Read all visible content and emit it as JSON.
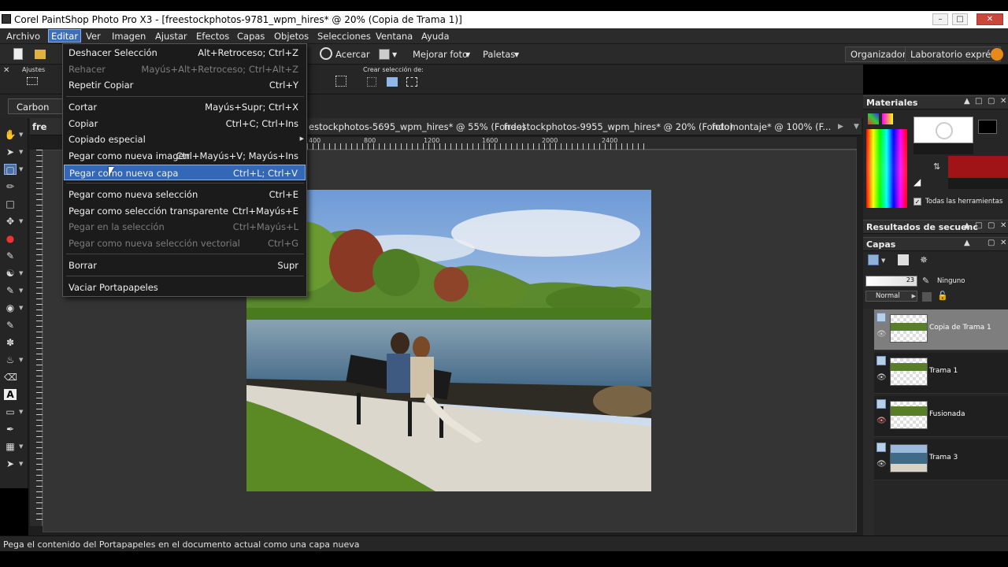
{
  "window": {
    "title": "Corel PaintShop Photo Pro X3 - [freestockphotos-9781_wpm_hires* @  20% (Copia de Trama 1)]",
    "controls": [
      "minimize-icon",
      "maximize-icon",
      "close-icon"
    ]
  },
  "menubar": [
    "Archivo",
    "Editar",
    "Ver",
    "Imagen",
    "Ajustar",
    "Efectos",
    "Capas",
    "Objetos",
    "Selecciones",
    "Ventana",
    "Ayuda"
  ],
  "toolbar": {
    "zoom_label": "Acercar",
    "enhance_label": "Mejorar foto",
    "palettes_label": "Paletas",
    "organizer_label": "Organizador",
    "lab_label": "Laboratorio exprés"
  },
  "optbar": {
    "ajustes_label": "Ajustes",
    "crear_seleccion_label": "Crear selección de:",
    "carbon_label": "Carbon",
    "doc_prefix_label": "fre"
  },
  "edit_menu": {
    "items": [
      {
        "label": "Deshacer Selección",
        "shortcut": "Alt+Retroceso; Ctrl+Z",
        "enabled": true
      },
      {
        "label": "Rehacer",
        "shortcut": "Mayús+Alt+Retroceso; Ctrl+Alt+Z",
        "enabled": false
      },
      {
        "label": "Repetir  Copiar",
        "shortcut": "Ctrl+Y",
        "enabled": true
      },
      {
        "label": "Cortar",
        "shortcut": "Mayús+Supr; Ctrl+X",
        "enabled": true
      },
      {
        "label": "Copiar",
        "shortcut": "Ctrl+C; Ctrl+Ins",
        "enabled": true
      },
      {
        "label": "Copiado especial",
        "shortcut": "",
        "enabled": true
      },
      {
        "label": "Pegar como nueva imagen",
        "shortcut": "Ctrl+Mayús+V; Mayús+Ins",
        "enabled": true
      },
      {
        "label": "Pegar como nueva capa",
        "shortcut": "Ctrl+L; Ctrl+V",
        "enabled": true
      },
      {
        "label": "Pegar como nueva selección",
        "shortcut": "Ctrl+E",
        "enabled": true
      },
      {
        "label": "Pegar como selección transparente",
        "shortcut": "Ctrl+Mayús+E",
        "enabled": true
      },
      {
        "label": "Pegar en la selección",
        "shortcut": "Ctrl+Mayús+L",
        "enabled": false
      },
      {
        "label": "Pegar como nueva selección vectorial",
        "shortcut": "Ctrl+G",
        "enabled": false
      },
      {
        "label": "Borrar",
        "shortcut": "Supr",
        "enabled": true
      },
      {
        "label": "Vaciar Portapapeles",
        "shortcut": "",
        "enabled": true
      }
    ],
    "highlighted_item": "Pegar como nueva capa"
  },
  "doc_tabs": [
    "estockphotos-5695_wpm_hires* @  55% (Fondo)",
    "freestockphotos-9955_wpm_hires* @  20% (Fondo)",
    "fotomontaje* @ 100% (F..."
  ],
  "rulers": {
    "top": [
      "400",
      "800",
      "1200",
      "1600",
      "2000",
      "2400"
    ]
  },
  "panels": {
    "materiales": "Materiales",
    "todas_herramientas": "Todas las herramientas",
    "resultados": "Resultados de secuenc",
    "capas": "Capas"
  },
  "layers_panel": {
    "opacity": "23",
    "mask_label": "Ninguno",
    "blend_mode": "Normal",
    "layers": [
      {
        "name": "Copia de Trama 1",
        "selected": true
      },
      {
        "name": "Trama 1",
        "selected": false
      },
      {
        "name": "Fusionada",
        "selected": false
      },
      {
        "name": "Trama 3",
        "selected": false
      }
    ]
  },
  "colors": {
    "foreground": "#000000",
    "background": "#a01418",
    "menu_highlight": "#3467b5"
  },
  "status_text": "Pega el contenido del Portapapeles en el documento actual como una capa nueva"
}
